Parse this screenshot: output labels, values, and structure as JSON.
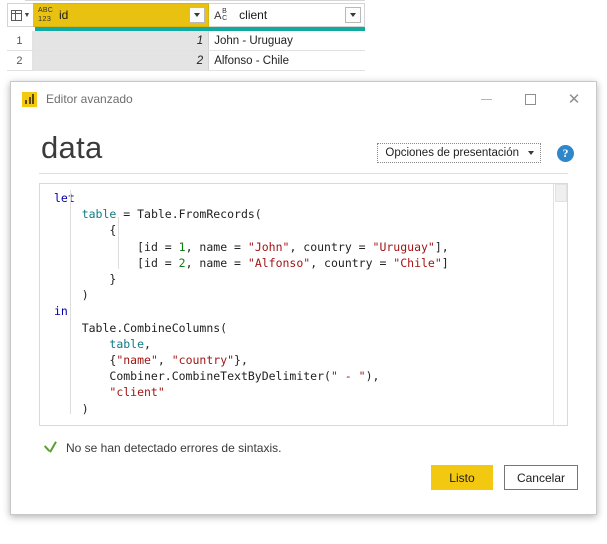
{
  "grid": {
    "corner_icon": "table-selector-icon",
    "columns": [
      {
        "name": "id",
        "label": "id",
        "type_icon": "abc-123-icon",
        "type_icon_line1": "ABC",
        "type_icon_line2": "123",
        "selected": true
      },
      {
        "name": "client",
        "label": "client",
        "type_icon": "abc-text-icon",
        "type_icon_a": "A",
        "type_icon_b": "B",
        "type_icon_c": "C",
        "selected": false
      }
    ],
    "rows": [
      {
        "num": "1",
        "id": "1",
        "client": "John - Uruguay"
      },
      {
        "num": "2",
        "id": "2",
        "client": "Alfonso - Chile"
      }
    ],
    "accent_bar_color": "#12a9a0",
    "selected_header_color": "#e8c111"
  },
  "dialog": {
    "app_icon": "power-bi-icon",
    "title_bar_text": "Editor avanzado",
    "window_controls": {
      "minimize": "minimize-icon",
      "maximize": "maximize-icon",
      "close": "close-icon"
    },
    "heading": "data",
    "display_options": {
      "label": "Opciones de presentación",
      "caret": "chevron-down-icon"
    },
    "help_icon_glyph": "?",
    "editor": {
      "lines": [
        {
          "indent": 0,
          "tokens": [
            {
              "t": "let",
              "c": "k"
            }
          ]
        },
        {
          "indent": 1,
          "tokens": [
            {
              "t": "table ",
              "c": "id"
            },
            {
              "t": "= Table.FromRecords(",
              "c": "p"
            }
          ]
        },
        {
          "indent": 2,
          "tokens": [
            {
              "t": "{",
              "c": "p"
            }
          ]
        },
        {
          "indent": 3,
          "tokens": [
            {
              "t": "[id = ",
              "c": "p"
            },
            {
              "t": "1",
              "c": "n"
            },
            {
              "t": ", name = ",
              "c": "p"
            },
            {
              "t": "\"John\"",
              "c": "s"
            },
            {
              "t": ", country = ",
              "c": "p"
            },
            {
              "t": "\"Uruguay\"",
              "c": "s"
            },
            {
              "t": "],",
              "c": "p"
            }
          ]
        },
        {
          "indent": 3,
          "tokens": [
            {
              "t": "[id = ",
              "c": "p"
            },
            {
              "t": "2",
              "c": "n"
            },
            {
              "t": ", name = ",
              "c": "p"
            },
            {
              "t": "\"Alfonso\"",
              "c": "s"
            },
            {
              "t": ", country = ",
              "c": "p"
            },
            {
              "t": "\"Chile\"",
              "c": "s"
            },
            {
              "t": "]",
              "c": "p"
            }
          ]
        },
        {
          "indent": 2,
          "tokens": [
            {
              "t": "}",
              "c": "p"
            }
          ]
        },
        {
          "indent": 1,
          "tokens": [
            {
              "t": ")",
              "c": "p"
            }
          ]
        },
        {
          "indent": 0,
          "tokens": [
            {
              "t": "in",
              "c": "k"
            }
          ]
        },
        {
          "indent": 1,
          "tokens": [
            {
              "t": "Table.CombineColumns(",
              "c": "p"
            }
          ]
        },
        {
          "indent": 2,
          "tokens": [
            {
              "t": "table",
              "c": "id"
            },
            {
              "t": ",",
              "c": "p"
            }
          ]
        },
        {
          "indent": 2,
          "tokens": [
            {
              "t": "{",
              "c": "p"
            },
            {
              "t": "\"name\"",
              "c": "s"
            },
            {
              "t": ", ",
              "c": "p"
            },
            {
              "t": "\"country\"",
              "c": "s"
            },
            {
              "t": "},",
              "c": "p"
            }
          ]
        },
        {
          "indent": 2,
          "tokens": [
            {
              "t": "Combiner.CombineTextByDelimiter(",
              "c": "p"
            },
            {
              "t": "\" - \"",
              "c": "s"
            },
            {
              "t": "),",
              "c": "p"
            }
          ]
        },
        {
          "indent": 2,
          "tokens": [
            {
              "t": "\"client\"",
              "c": "s"
            }
          ]
        },
        {
          "indent": 1,
          "tokens": [
            {
              "t": ")",
              "c": "p"
            }
          ]
        }
      ]
    },
    "status": {
      "icon": "check-icon",
      "text": "No se han detectado errores de sintaxis."
    },
    "buttons": {
      "primary_label": "Listo",
      "secondary_label": "Cancelar",
      "primary_color": "#f2c811"
    }
  }
}
